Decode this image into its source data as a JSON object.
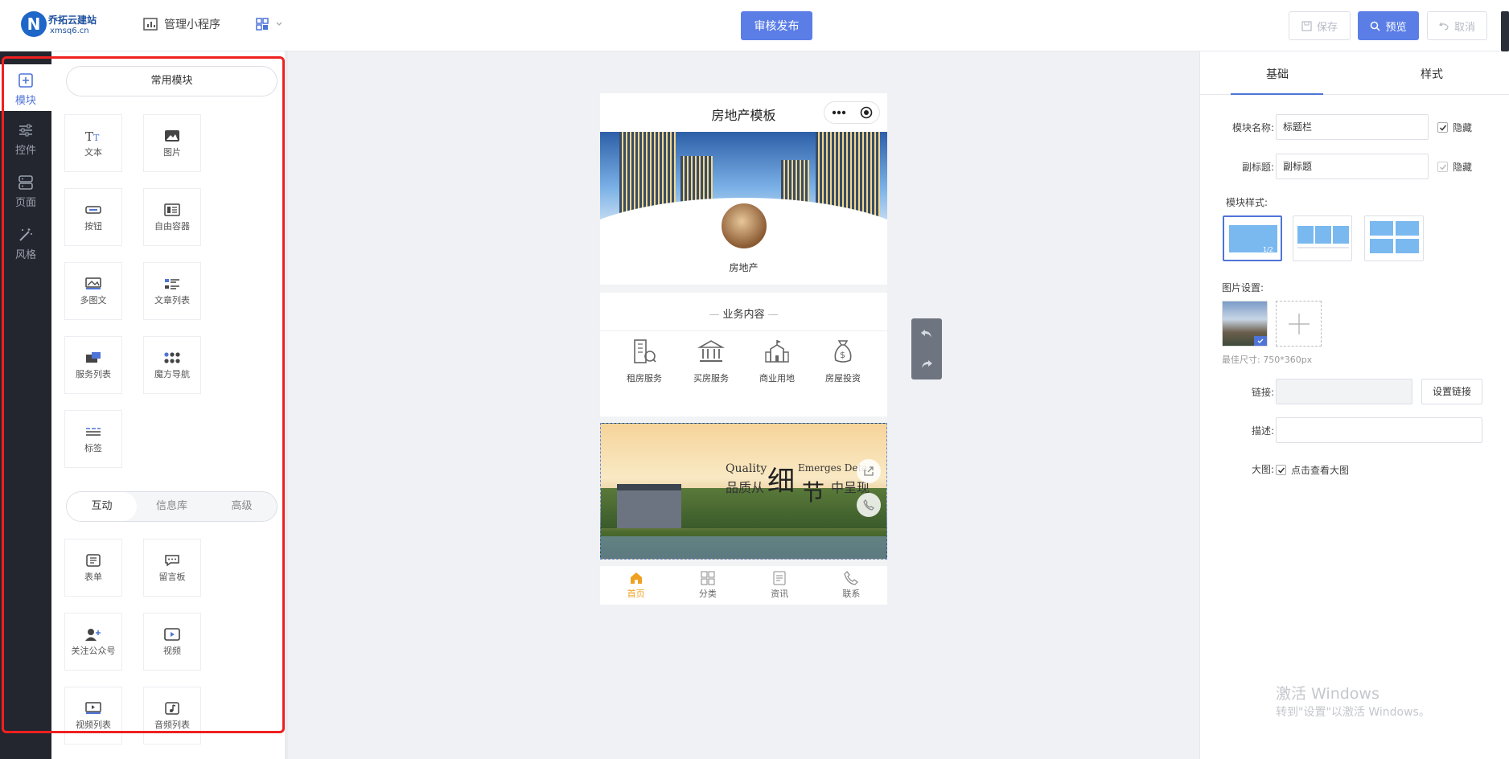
{
  "topbar": {
    "logo_mark": "N",
    "logo_name": "乔拓云建站",
    "logo_url": "xmsq6.cn",
    "manage_label": "管理小程序",
    "publish_label": "审核发布",
    "save_label": "保存",
    "preview_label": "预览",
    "cancel_label": "取消"
  },
  "rail": [
    {
      "label": "模块",
      "icon": "plus-square-icon"
    },
    {
      "label": "控件",
      "icon": "sliders-icon"
    },
    {
      "label": "页面",
      "icon": "server-icon"
    },
    {
      "label": "风格",
      "icon": "magic-wand-icon"
    }
  ],
  "modules": {
    "common_title": "常用模块",
    "common": [
      "文本",
      "图片",
      "按钮",
      "自由容器",
      "多图文",
      "文章列表",
      "服务列表",
      "魔方导航",
      "标签"
    ],
    "tabs": [
      "互动",
      "信息库",
      "高级"
    ],
    "interactive": [
      "表单",
      "留言板",
      "关注公众号",
      "视频",
      "视频列表",
      "音频列表"
    ]
  },
  "phone": {
    "title": "房地产模板",
    "avatar_label": "房地产",
    "section_title": "业务内容",
    "services": [
      "租房服务",
      "买房服务",
      "商业用地",
      "房屋投资"
    ],
    "banner_text_1": "Quality",
    "banner_text_2": "Emerges Deta",
    "banner_text_3": "品质从",
    "banner_text_4": "细",
    "banner_text_5": "节",
    "banner_text_6": "中呈现",
    "tabbar": [
      "首页",
      "分类",
      "资讯",
      "联系"
    ],
    "accent": "#f0a020"
  },
  "right": {
    "tab_basic": "基础",
    "tab_style": "样式",
    "module_name_label": "模块名称:",
    "module_name_value": "标题栏",
    "hide_label": "隐藏",
    "subtitle_label": "副标题:",
    "subtitle_value": "副标题",
    "hide_label_2": "隐藏",
    "module_style_label": "模块样式:",
    "layout_badge": "1/2",
    "image_settings_label": "图片设置:",
    "best_size": "最佳尺寸: 750*360px",
    "link_label": "链接:",
    "set_link_label": "设置链接",
    "desc_label": "描述:",
    "bigimg_label": "大图:",
    "bigimg_option": "点击查看大图"
  },
  "watermark": {
    "line1": "激活 Windows",
    "line2": "转到\"设置\"以激活 Windows。"
  },
  "colors": {
    "primary": "#5b7ee6",
    "highlight": "#f02020"
  }
}
